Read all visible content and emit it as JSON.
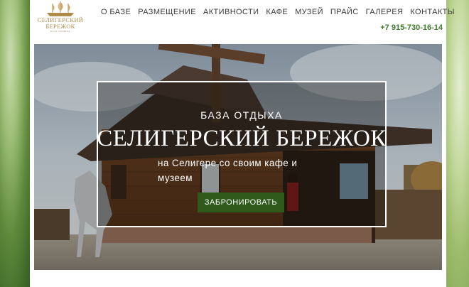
{
  "logo": {
    "line1": "СЕЛИГЕРСКИЙ",
    "line2": "БЕРЕЖОК",
    "small": "БАЗА ОТДЫХА"
  },
  "nav": {
    "items": [
      {
        "label": "О БАЗЕ"
      },
      {
        "label": "РАЗМЕЩЕНИЕ"
      },
      {
        "label": "АКТИВНОСТИ"
      },
      {
        "label": "КАФЕ"
      },
      {
        "label": "МУЗЕЙ"
      },
      {
        "label": "ПРАЙС"
      },
      {
        "label": "ГАЛЕРЕЯ"
      },
      {
        "label": "КОНТАКТЫ"
      }
    ]
  },
  "phone": "+7 915-730-16-14",
  "hero": {
    "subtitle": "БАЗА ОТДЫХА",
    "title": "СЕЛИГЕРСКИЙ БЕРЕЖОК",
    "description": "на Селигере со своим кафе и музеем",
    "button_label": "ЗАБРОНИРОВАТЬ"
  },
  "colors": {
    "accent": "#3e7a2a",
    "button": "#2f5a1c",
    "logo_gold": "#b08c4a"
  }
}
